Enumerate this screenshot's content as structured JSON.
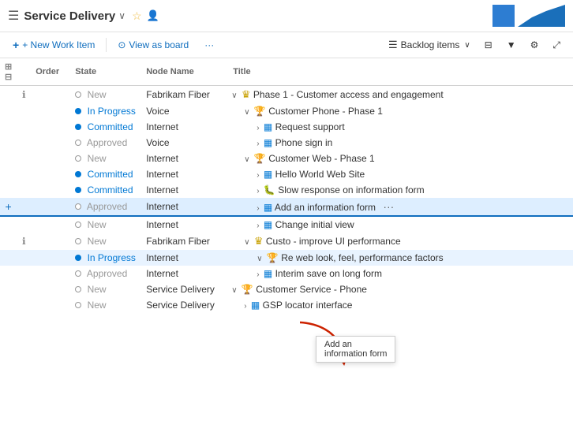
{
  "header": {
    "grid_icon": "☰",
    "title": "Service Delivery",
    "chevron": "∨",
    "star_icon": "☆",
    "people_icon": "👤"
  },
  "toolbar": {
    "new_work_item_label": "+ New Work Item",
    "view_as_board_label": "View as board",
    "more_icon": "···",
    "backlog_items_label": "Backlog items",
    "chevron_down": "∨",
    "filter_icon": "⚡",
    "settings_icon": "⚙",
    "expand_icon": "⤢"
  },
  "columns": [
    {
      "id": "add",
      "label": ""
    },
    {
      "id": "info",
      "label": ""
    },
    {
      "id": "order",
      "label": "Order"
    },
    {
      "id": "state",
      "label": "State"
    },
    {
      "id": "node",
      "label": "Node Name"
    },
    {
      "id": "title",
      "label": "Title"
    }
  ],
  "rows": [
    {
      "id": 1,
      "add": "",
      "info": "ℹ",
      "order": "",
      "state_dot": "empty",
      "state_text": "New",
      "node": "Fabrikam Fiber",
      "indent": 1,
      "expand": "∨",
      "icon": "crown",
      "title": "Phase 1 - Customer access and engagement",
      "ellipsis": ""
    },
    {
      "id": 2,
      "add": "",
      "info": "",
      "order": "",
      "state_dot": "blue",
      "state_text": "In Progress",
      "node": "Voice",
      "indent": 2,
      "expand": "∨",
      "icon": "trophy",
      "title": "Customer Phone - Phase 1",
      "ellipsis": ""
    },
    {
      "id": 3,
      "add": "",
      "info": "",
      "order": "",
      "state_dot": "blue",
      "state_text": "Committed",
      "node": "Internet",
      "indent": 3,
      "expand": "›",
      "icon": "board",
      "title": "Request support",
      "ellipsis": ""
    },
    {
      "id": 4,
      "add": "",
      "info": "",
      "order": "",
      "state_dot": "empty",
      "state_text": "Approved",
      "node": "Voice",
      "indent": 3,
      "expand": "›",
      "icon": "board",
      "title": "Phone sign in",
      "ellipsis": ""
    },
    {
      "id": 5,
      "add": "",
      "info": "",
      "order": "",
      "state_dot": "empty",
      "state_text": "New",
      "node": "Internet",
      "indent": 2,
      "expand": "∨",
      "icon": "trophy",
      "title": "Customer Web - Phase 1",
      "ellipsis": ""
    },
    {
      "id": 6,
      "add": "",
      "info": "",
      "order": "",
      "state_dot": "blue",
      "state_text": "Committed",
      "node": "Internet",
      "indent": 3,
      "expand": "›",
      "icon": "board",
      "title": "Hello World Web Site",
      "ellipsis": ""
    },
    {
      "id": 7,
      "add": "",
      "info": "",
      "order": "",
      "state_dot": "blue",
      "state_text": "Committed",
      "node": "Internet",
      "indent": 3,
      "expand": "›",
      "icon": "bug",
      "title": "Slow response on information form",
      "ellipsis": ""
    },
    {
      "id": 8,
      "add": "+",
      "info": "",
      "order": "",
      "state_dot": "empty",
      "state_text": "Approved",
      "node": "Internet",
      "indent": 3,
      "expand": "›",
      "icon": "board",
      "title": "Add an information form",
      "ellipsis": "···",
      "highlight": true
    },
    {
      "id": 9,
      "add": "",
      "info": "",
      "order": "",
      "state_dot": "empty",
      "state_text": "New",
      "node": "Internet",
      "indent": 3,
      "expand": "›",
      "icon": "board",
      "title": "Change initial view",
      "ellipsis": ""
    },
    {
      "id": 10,
      "add": "",
      "info": "ℹ",
      "order": "",
      "state_dot": "empty",
      "state_text": "New",
      "node": "Fabrikam Fiber",
      "indent": 2,
      "expand": "∨",
      "icon": "crown",
      "title": "Custo  - improve UI performance",
      "ellipsis": ""
    },
    {
      "id": 11,
      "add": "",
      "info": "",
      "order": "",
      "state_dot": "blue",
      "state_text": "In Progress",
      "node": "Internet",
      "indent": 3,
      "expand": "∨",
      "icon": "trophy",
      "title": "Re  web look, feel, performance factors",
      "ellipsis": "",
      "row_highlight": true
    },
    {
      "id": 12,
      "add": "",
      "info": "",
      "order": "",
      "state_dot": "empty",
      "state_text": "Approved",
      "node": "Internet",
      "indent": 3,
      "expand": "›",
      "icon": "board",
      "title": "Interim save on long form",
      "ellipsis": ""
    },
    {
      "id": 13,
      "add": "",
      "info": "",
      "order": "",
      "state_dot": "empty",
      "state_text": "New",
      "node": "Service Delivery",
      "indent": 1,
      "expand": "∨",
      "icon": "trophy",
      "title": "Customer Service - Phone",
      "ellipsis": ""
    },
    {
      "id": 14,
      "add": "",
      "info": "",
      "order": "",
      "state_dot": "empty",
      "state_text": "New",
      "node": "Service Delivery",
      "indent": 2,
      "expand": "›",
      "icon": "board",
      "title": "GSP locator interface",
      "ellipsis": ""
    }
  ],
  "tooltip": {
    "line1": "Add an",
    "line2": "information form"
  }
}
